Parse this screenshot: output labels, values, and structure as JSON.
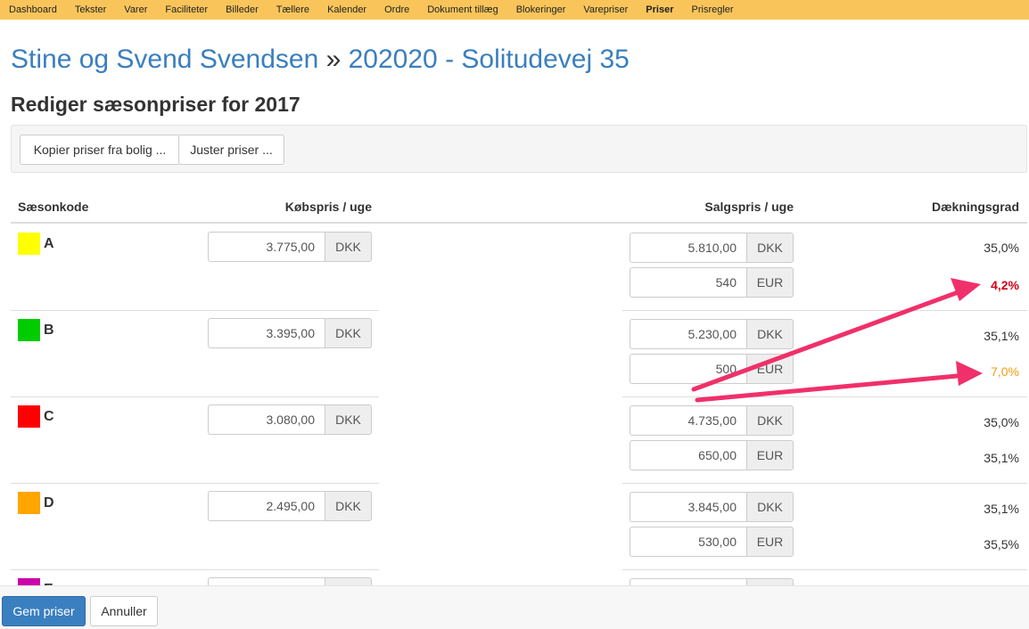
{
  "nav": {
    "items": [
      "Dashboard",
      "Tekster",
      "Varer",
      "Faciliteter",
      "Billeder",
      "Tællere",
      "Kalender",
      "Ordre",
      "Dokument tillæg",
      "Blokeringer",
      "Varepriser",
      "Priser",
      "Prisregler"
    ],
    "active": "Priser"
  },
  "header": {
    "owner": "Stine og Svend Svendsen",
    "separator": "»",
    "property": "202020 - Solitudevej 35",
    "subtitle": "Rediger sæsonpriser for 2017"
  },
  "toolbar": {
    "copy_label": "Kopier priser fra bolig ...",
    "adjust_label": "Juster priser ..."
  },
  "table": {
    "headers": {
      "season": "Sæsonkode",
      "purchase": "Købspris / uge",
      "sale": "Salgspris / uge",
      "coverage": "Dækningsgrad"
    },
    "rows": [
      {
        "code": "A",
        "color": "#ffff00",
        "purchase": "3.775,00",
        "purchase_currency": "DKK",
        "sale_dkk": "5.810,00",
        "sale_dkk_currency": "DKK",
        "sale_eur": "540",
        "sale_eur_currency": "EUR",
        "coverage_dkk": "35,0%",
        "coverage_eur": "4,2%"
      },
      {
        "code": "B",
        "color": "#00cc00",
        "purchase": "3.395,00",
        "purchase_currency": "DKK",
        "sale_dkk": "5.230,00",
        "sale_dkk_currency": "DKK",
        "sale_eur": "500",
        "sale_eur_currency": "EUR",
        "coverage_dkk": "35,1%",
        "coverage_eur": "7,0%"
      },
      {
        "code": "C",
        "color": "#ff0000",
        "purchase": "3.080,00",
        "purchase_currency": "DKK",
        "sale_dkk": "4.735,00",
        "sale_dkk_currency": "DKK",
        "sale_eur": "650,00",
        "sale_eur_currency": "EUR",
        "coverage_dkk": "35,0%",
        "coverage_eur": "35,1%"
      },
      {
        "code": "D",
        "color": "#ffa500",
        "purchase": "2.495,00",
        "purchase_currency": "DKK",
        "sale_dkk": "3.845,00",
        "sale_dkk_currency": "DKK",
        "sale_eur": "530,00",
        "sale_eur_currency": "EUR",
        "coverage_dkk": "35,1%",
        "coverage_eur": "35,5%"
      },
      {
        "code": "E",
        "color": "#cc00aa"
      }
    ]
  },
  "footer": {
    "save_label": "Gem priser",
    "cancel_label": "Annuller"
  },
  "colors": {
    "nav_bg": "#f9c55b",
    "title_blue": "#3a7fbf",
    "arrow_pink": "#f0306a",
    "warning_red": "#d0021b",
    "warning_orange": "#f39c12"
  }
}
